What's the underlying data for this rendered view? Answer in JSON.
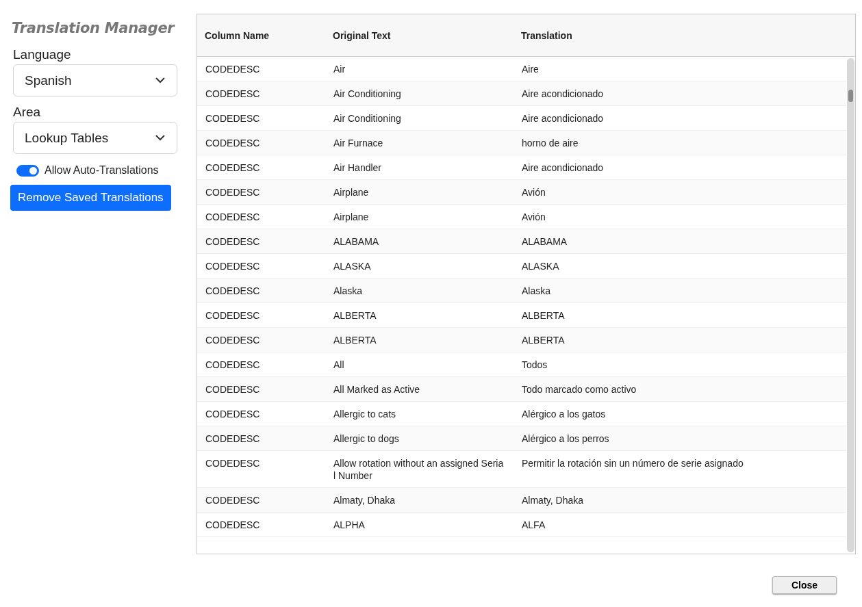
{
  "title": "Translation Manager",
  "language": {
    "label": "Language",
    "value": "Spanish"
  },
  "area": {
    "label": "Area",
    "value": "Lookup Tables"
  },
  "auto_translate": {
    "label": "Allow Auto-Translations",
    "on": true
  },
  "remove_button": "Remove Saved Translations",
  "table": {
    "columns": [
      "Column Name",
      "Original Text",
      "Translation"
    ],
    "rows": [
      [
        "CODEDESC",
        "Air",
        "Aire"
      ],
      [
        "CODEDESC",
        "Air Conditioning",
        "Aire acondicionado"
      ],
      [
        "CODEDESC",
        "Air Conditioning",
        "Aire acondicionado"
      ],
      [
        "CODEDESC",
        "Air Furnace",
        "horno de aire"
      ],
      [
        "CODEDESC",
        "Air Handler",
        "Aire acondicionado"
      ],
      [
        "CODEDESC",
        "Airplane",
        "Avión"
      ],
      [
        "CODEDESC",
        "Airplane",
        "Avión"
      ],
      [
        "CODEDESC",
        "ALABAMA",
        "ALABAMA"
      ],
      [
        "CODEDESC",
        "ALASKA",
        "ALASKA"
      ],
      [
        "CODEDESC",
        "Alaska",
        "Alaska"
      ],
      [
        "CODEDESC",
        "ALBERTA",
        "ALBERTA"
      ],
      [
        "CODEDESC",
        "ALBERTA",
        "ALBERTA"
      ],
      [
        "CODEDESC",
        "All",
        "Todos"
      ],
      [
        "CODEDESC",
        "All Marked as Active",
        "Todo marcado como activo"
      ],
      [
        "CODEDESC",
        "Allergic to cats",
        "Alérgico a los gatos"
      ],
      [
        "CODEDESC",
        "Allergic to dogs",
        "Alérgico a los perros"
      ],
      [
        "CODEDESC",
        "Allow rotation without an assigned Serial Number",
        "Permitir la rotación sin un número de serie asignado"
      ],
      [
        "CODEDESC",
        "Almaty, Dhaka",
        "Almaty, Dhaka"
      ],
      [
        "CODEDESC",
        "ALPHA",
        "ALFA"
      ]
    ]
  },
  "close_button": "Close"
}
